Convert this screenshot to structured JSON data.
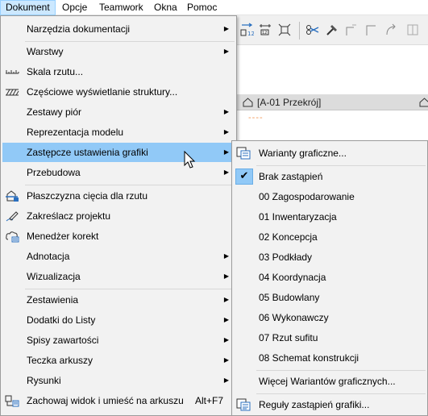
{
  "menubar": {
    "items": [
      "Dokument",
      "Opcje",
      "Teamwork",
      "Okna",
      "Pomoc"
    ]
  },
  "background": {
    "tab1_label": "[A-01 Przekrój]",
    "dashes": "----"
  },
  "main_menu": {
    "items": [
      {
        "label": "Narzędzia dokumentacji",
        "submenu": true
      },
      {
        "label": "Warstwy",
        "submenu": true
      },
      {
        "label": "Skala rzutu...",
        "submenu": false,
        "icon": "scale-ruler-icon"
      },
      {
        "label": "Częściowe wyświetlanie struktury...",
        "submenu": false,
        "icon": "hatch-structure-icon"
      },
      {
        "label": "Zestawy piór",
        "submenu": true
      },
      {
        "label": "Reprezentacja modelu",
        "submenu": true
      },
      {
        "label": "Zastępcze ustawienia grafiki",
        "submenu": true,
        "highlighted": true
      },
      {
        "label": "Przebudowa",
        "submenu": true
      },
      {
        "label": "Płaszczyzna cięcia dla rzutu",
        "submenu": false,
        "icon": "cut-plane-icon"
      },
      {
        "label": "Zakreślacz projektu",
        "submenu": false,
        "icon": "marker-pen-icon"
      },
      {
        "label": "Menedżer korekt",
        "submenu": false,
        "icon": "cloud-revision-icon"
      },
      {
        "label": "Adnotacja",
        "submenu": true
      },
      {
        "label": "Wizualizacja",
        "submenu": true
      },
      {
        "label": "Zestawienia",
        "submenu": true
      },
      {
        "label": "Dodatki do Listy",
        "submenu": true
      },
      {
        "label": "Spisy zawartości",
        "submenu": true
      },
      {
        "label": "Teczka arkuszy",
        "submenu": true
      },
      {
        "label": "Rysunki",
        "submenu": true
      },
      {
        "label": "Zachowaj widok i umieść na arkuszu",
        "submenu": false,
        "icon": "place-view-icon",
        "shortcut": "Alt+F7"
      }
    ]
  },
  "sub_menu": {
    "items": [
      {
        "label": "Warianty graficzne...",
        "icon": "graphic-variants-icon"
      },
      {
        "label": "Brak zastąpień",
        "checked": true
      },
      {
        "label": "00 Zagospodarowanie"
      },
      {
        "label": "01 Inwentaryzacja"
      },
      {
        "label": "02 Koncepcja"
      },
      {
        "label": "03 Podkłady"
      },
      {
        "label": "04 Koordynacja"
      },
      {
        "label": "05 Budowlany"
      },
      {
        "label": "06 Wykonawczy"
      },
      {
        "label": "07 Rzut sufitu"
      },
      {
        "label": "08 Schemat konstrukcji"
      },
      {
        "label": "Więcej Wariantów graficznych..."
      },
      {
        "label": "Reguły zastąpień grafiki...",
        "icon": "override-rules-icon"
      }
    ]
  },
  "colors": {
    "highlight": "#91c9f7",
    "menubar_active": "#cce8ff"
  }
}
